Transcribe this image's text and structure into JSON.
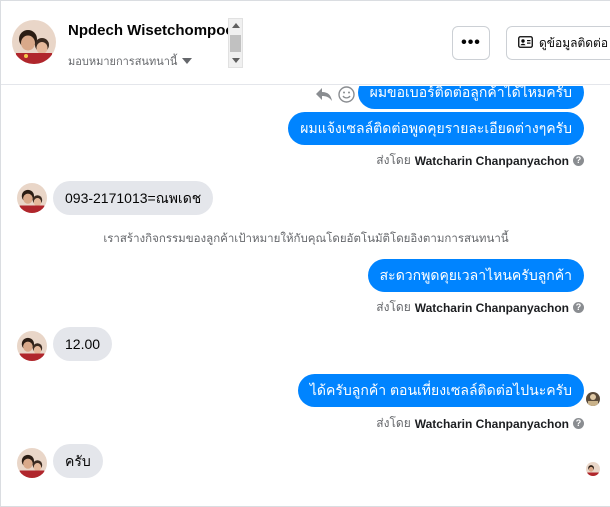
{
  "header": {
    "name": "Npdech Wisetchompooh",
    "assign_label": "มอบหมายการสนทนานี้",
    "more_label": "•••",
    "contact_label": "ดูข้อมูลติดต่อ"
  },
  "messages": {
    "out_1": "ผมขอเบอร์ติดต่อลูกค้าได้ไหมครับ",
    "out_2": "ผมแจ้งเซลล์ติดต่อพูดคุยรายละเอียดต่างๆครับ",
    "sent_by_1_prefix": "ส่งโดย",
    "sent_by_1_name": "Watcharin Chanpanyachon",
    "in_1": "093-2171013=ณพเดช",
    "system_1": "เราสร้างกิจกรรมของลูกค้าเป้าหมายให้กับคุณโดยอัตโนมัติโดยอิงตามการสนทนานี้",
    "out_3": "สะดวกพูดคุยเวลาไหนครับลูกค้า",
    "sent_by_2_prefix": "ส่งโดย",
    "sent_by_2_name": "Watcharin Chanpanyachon",
    "in_2": "12.00",
    "out_4": "ได้ครับลูกค้า ตอนเที่ยงเซลล์ติดต่อไปนะครับ",
    "sent_by_3_prefix": "ส่งโดย",
    "sent_by_3_name": "Watcharin Chanpanyachon",
    "in_3": "ครับ"
  },
  "icons": {
    "more": "more-icon",
    "contact": "contact-card-icon",
    "reply": "reply-icon",
    "emoji": "emoji-icon",
    "help": "question-icon"
  },
  "colors": {
    "outgoing_bubble": "#0084ff",
    "incoming_bubble": "#e4e6eb",
    "secondary_text": "#65676b"
  }
}
